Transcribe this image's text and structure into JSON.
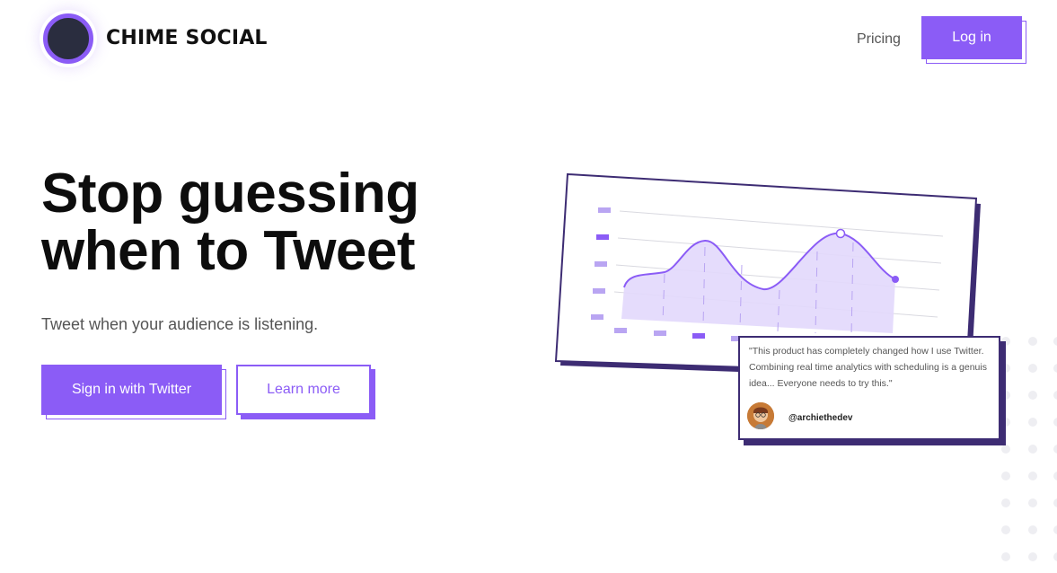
{
  "header": {
    "brand": "CHIME SOCIAL",
    "nav_pricing": "Pricing",
    "login_label": "Log in"
  },
  "hero": {
    "headline_line1": "Stop guessing",
    "headline_line2": "when to Tweet",
    "subtitle": "Tweet when your audience is listening.",
    "primary_cta": "Sign in with Twitter",
    "secondary_cta": "Learn more"
  },
  "testimonial": {
    "quote": "\"This product has completely changed how I use Twitter. Combining real time analytics with scheduling is a genuis idea... Everyone needs to try this.\"",
    "handle": "@archiethedev"
  },
  "colors": {
    "accent": "#8b5cf6",
    "accent_light": "#ddd2fb",
    "dark": "#3d2c73"
  }
}
